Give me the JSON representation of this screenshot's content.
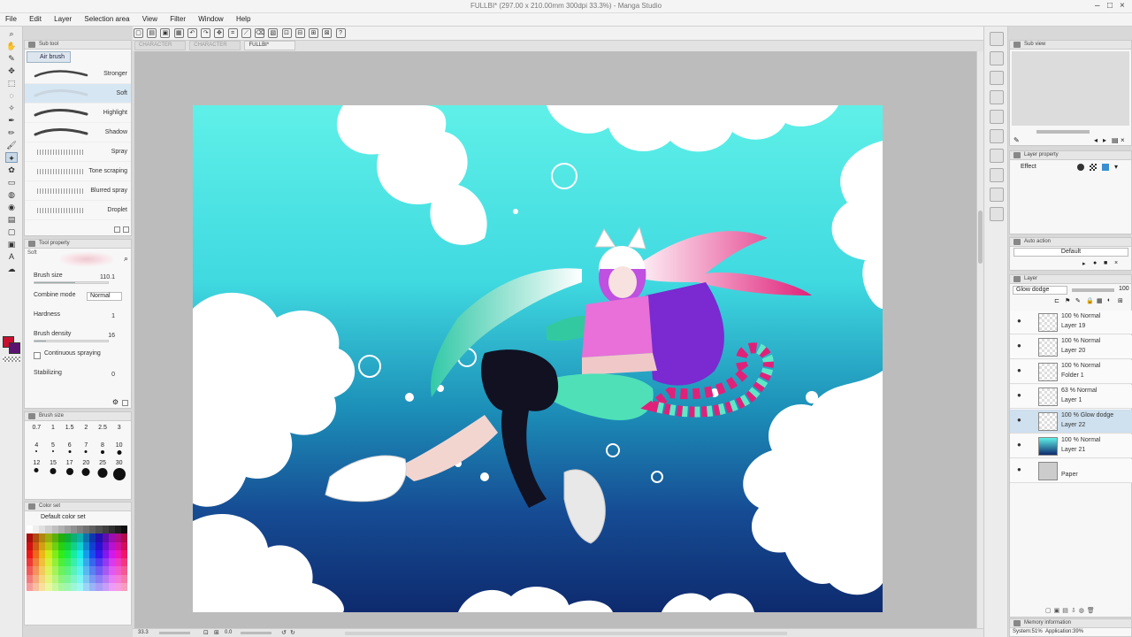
{
  "window": {
    "title": "FULLBI* (297.00 x 210.00mm 300dpi 33.3%) - Manga Studio"
  },
  "menu": [
    "File",
    "Edit",
    "Layer",
    "Selection area",
    "View",
    "Filter",
    "Window",
    "Help"
  ],
  "tabs": [
    "CHARACTER",
    "CHARACTER",
    "FULLBI*"
  ],
  "subtool": {
    "header": "Sub tool",
    "group": "Air brush",
    "brushes": [
      {
        "label": "Stronger",
        "selected": false
      },
      {
        "label": "Soft",
        "selected": true
      },
      {
        "label": "Highlight",
        "selected": false
      },
      {
        "label": "Shadow",
        "selected": false
      },
      {
        "label": "Spray",
        "selected": false
      },
      {
        "label": "Tone scraping",
        "selected": false
      },
      {
        "label": "Blurred spray",
        "selected": false
      },
      {
        "label": "Droplet",
        "selected": false
      }
    ]
  },
  "tool_property": {
    "header": "Tool property",
    "preview_label": "Soft",
    "brush_size_label": "Brush size",
    "brush_size_value": "110.1",
    "brush_size_level": 0.55,
    "combine_mode_label": "Combine mode",
    "combine_mode_value": "Normal",
    "hardness_label": "Hardness",
    "hardness_value": "1",
    "brush_density_label": "Brush density",
    "brush_density_value": "16",
    "brush_density_level": 0.16,
    "continuous_label": "Continuous spraying",
    "stabilizing_label": "Stabilizing",
    "stabilizing_value": "0"
  },
  "brush_size_panel": {
    "header": "Brush size",
    "sizes": [
      "0.7",
      "1",
      "1.5",
      "2",
      "2.5",
      "3",
      "4",
      "5",
      "6",
      "7",
      "8",
      "10",
      "12",
      "15",
      "17",
      "20",
      "25",
      "30"
    ]
  },
  "color_set": {
    "header": "Color set",
    "selected": "Default color set"
  },
  "statusbar": {
    "zoom": "33.3",
    "angle": "0.0"
  },
  "layer_property": {
    "header": "Layer property",
    "effect_label": "Effect"
  },
  "auto_action": {
    "header": "Auto action",
    "selected": "Default"
  },
  "layer_panel": {
    "header": "Layer",
    "blend_mode": "Glow dodge",
    "opacity": "100",
    "layers": [
      {
        "line1": "100 % Normal",
        "line2": "Layer 19",
        "selected": false
      },
      {
        "line1": "100 % Normal",
        "line2": "Layer 20",
        "selected": false
      },
      {
        "line1": "100 % Normal",
        "line2": "Folder 1",
        "selected": false
      },
      {
        "line1": "63 % Normal",
        "line2": "Layer 1",
        "selected": false
      },
      {
        "line1": "100 % Glow dodge",
        "line2": "Layer 22",
        "selected": true
      },
      {
        "line1": "100 % Normal",
        "line2": "Layer 21",
        "selected": false
      },
      {
        "line1": "",
        "line2": "Paper",
        "selected": false
      }
    ]
  },
  "memory": {
    "header": "Memory information",
    "system": "System:51%",
    "application": "Application:39%"
  },
  "colors": {
    "main_color": "#c8102e",
    "sub_color": "#5a1470",
    "sky_top": "#5ff0e8",
    "deep": "#0e2a6e",
    "hair_pink": "#e0217a",
    "top_magenta": "#e870d8",
    "jacket_purple": "#7a2ad0"
  }
}
